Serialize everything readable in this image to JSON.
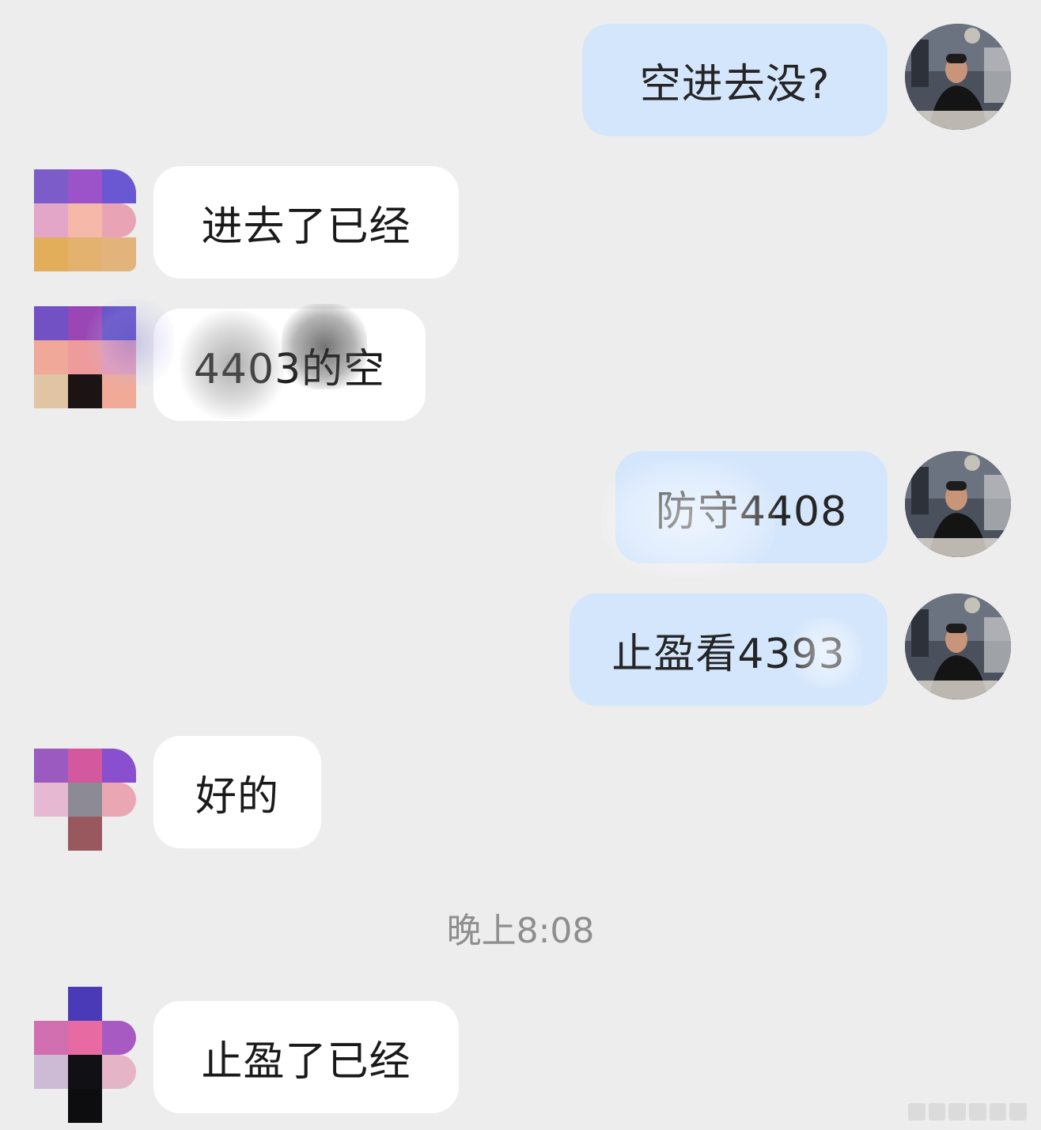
{
  "messages": [
    {
      "text": "空进去没?"
    },
    {
      "text": "进去了已经"
    },
    {
      "text": "4403的空"
    },
    {
      "text": "防守4408"
    },
    {
      "text": "止盈看4393"
    },
    {
      "text": "好的"
    },
    {
      "text": "止盈了已经"
    }
  ],
  "timestamp": "晚上8:08",
  "colors": {
    "background": "#ededed",
    "outgoing_bubble": "#d4e6fc",
    "incoming_bubble": "#ffffff",
    "timestamp_text": "#8e8e8e"
  }
}
